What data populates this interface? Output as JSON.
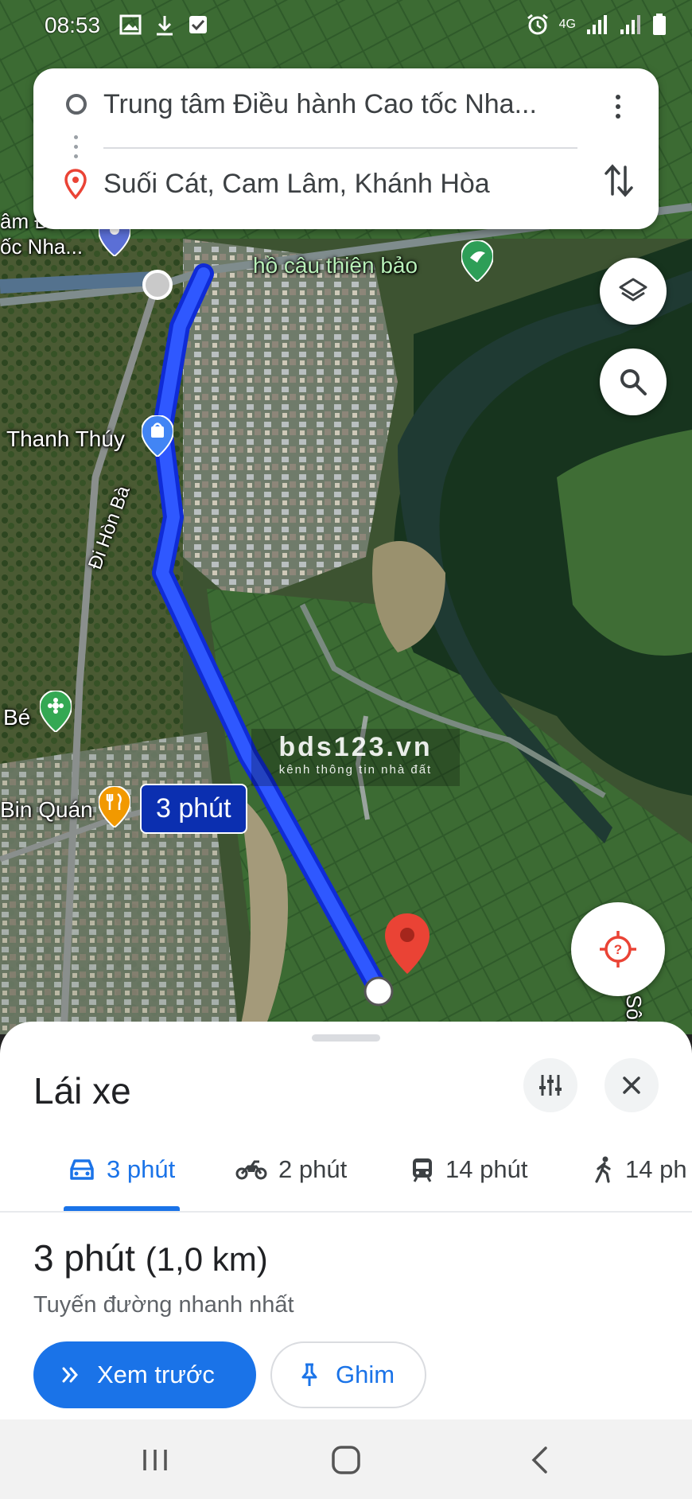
{
  "status_bar": {
    "time": "08:53",
    "network": "4G"
  },
  "route": {
    "origin": "Trung tâm Điều hành Cao tốc Nha...",
    "destination": "Suối Cát, Cam Lâm, Khánh Hòa"
  },
  "map": {
    "labels": {
      "poi_top": "hồ câu thiên bảo",
      "poi_left_top": "âm Đi\nốc Nha...",
      "shop": "Thanh Thúy",
      "road": "Đi Hòn Bà",
      "poi_be": "Bé",
      "restaurant": "Bin Quán",
      "river": "Sông"
    },
    "route_duration_callout": "3 phút",
    "route_color": "#1a3cff",
    "watermark": {
      "line1": "bds123.vn",
      "line2": "kênh thông tin nhà đất"
    }
  },
  "sheet": {
    "mode_title": "Lái xe",
    "tabs": [
      {
        "icon": "car-icon",
        "label": "3 phút",
        "active": true
      },
      {
        "icon": "motorbike-icon",
        "label": "2 phút",
        "active": false
      },
      {
        "icon": "transit-icon",
        "label": "14 phút",
        "active": false
      },
      {
        "icon": "walk-icon",
        "label": "14 ph",
        "active": false
      }
    ],
    "summary_time": "3 phút",
    "summary_distance": "(1,0 km)",
    "summary_sub": "Tuyến đường nhanh nhất",
    "preview_label": "Xem trước",
    "pin_label": "Ghim"
  },
  "colors": {
    "accent": "#1a73e8",
    "dest_marker": "#ea4335"
  }
}
